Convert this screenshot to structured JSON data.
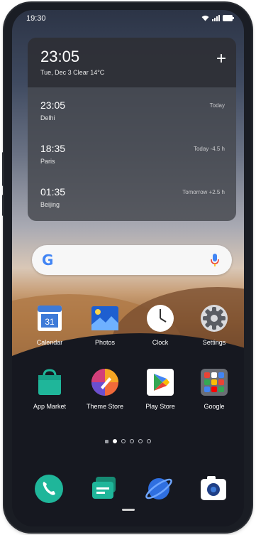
{
  "status_bar": {
    "time": "19:30"
  },
  "clock_widget": {
    "time": "23:05",
    "date_weather": "Tue, Dec 3 Clear 14°C",
    "add_label": "+",
    "cities": [
      {
        "time": "23:05",
        "name": "Delhi",
        "diff": "Today"
      },
      {
        "time": "18:35",
        "name": "Paris",
        "diff": "Today -4.5 h"
      },
      {
        "time": "01:35",
        "name": "Beijing",
        "diff": "Tomorrow +2.5 h"
      }
    ]
  },
  "search_bar": {
    "logo": "G",
    "mic_icon": "mic-icon"
  },
  "apps_row1": [
    {
      "label": "Calendar",
      "icon": "calendar-icon",
      "badge": "31"
    },
    {
      "label": "Photos",
      "icon": "photos-icon"
    },
    {
      "label": "Clock",
      "icon": "clock-icon"
    },
    {
      "label": "Settings",
      "icon": "gear-icon"
    }
  ],
  "apps_row2": [
    {
      "label": "App Market",
      "icon": "app-market-icon"
    },
    {
      "label": "Theme Store",
      "icon": "theme-store-icon"
    },
    {
      "label": "Play Store",
      "icon": "play-store-icon"
    },
    {
      "label": "Google",
      "icon": "google-folder-icon"
    }
  ],
  "page_indicator": {
    "pages": 6,
    "active": 1
  },
  "dock": [
    {
      "icon": "phone-icon"
    },
    {
      "icon": "messages-icon"
    },
    {
      "icon": "browser-icon"
    },
    {
      "icon": "camera-icon"
    }
  ],
  "colors": {
    "phone_green": "#1fb69a",
    "calendar_blue": "#3d7ad8",
    "photos_blue": "#1e5fd0",
    "theme_orange": "#f06a3a",
    "google_blue": "#4285f4",
    "google_red": "#ea4335",
    "google_yellow": "#fbbc05",
    "google_green": "#34a853"
  }
}
